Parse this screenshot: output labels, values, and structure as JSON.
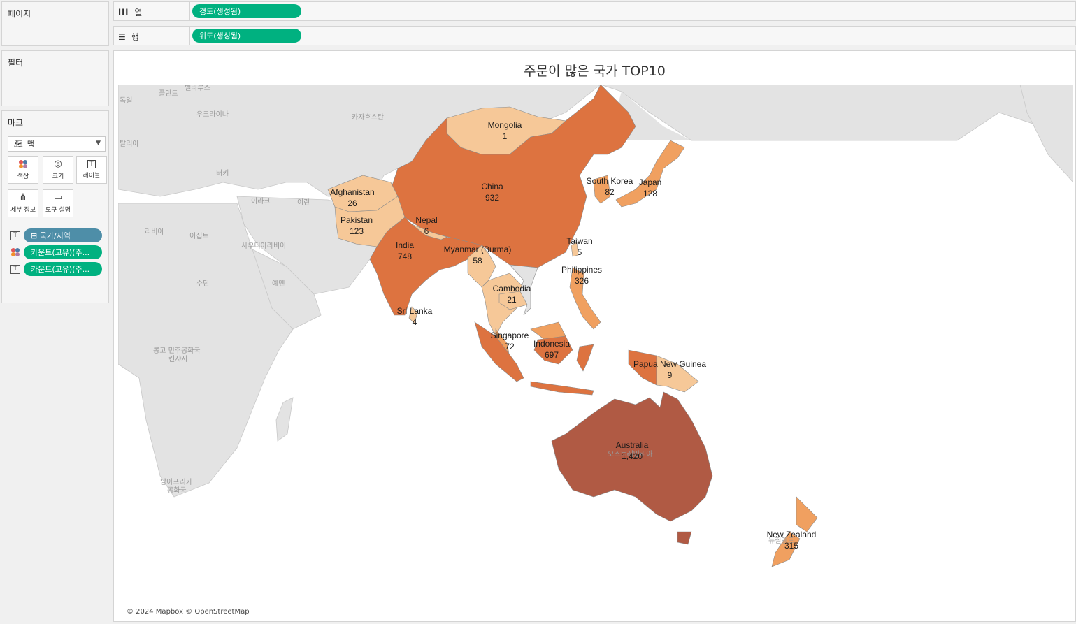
{
  "sidebar": {
    "pages_title": "페이지",
    "filters_title": "필터",
    "marks_title": "마크",
    "mark_type": "맵",
    "mark_buttons": {
      "color": "색상",
      "size": "크기",
      "label": "레이블",
      "detail": "세부 정보",
      "tooltip": "도구 설명"
    },
    "mark_pills": [
      {
        "label": "⊞ 국가/지역",
        "role": "label"
      },
      {
        "label": "카운트(고유)(주...",
        "role": "color"
      },
      {
        "label": "카운트(고유)(주...",
        "role": "label"
      }
    ]
  },
  "shelves": {
    "columns_label": "열",
    "columns_pill": "경도(생성됨)",
    "rows_label": "행",
    "rows_pill": "위도(생성됨)"
  },
  "viz": {
    "title": "주문이 많은 국가 TOP10",
    "attribution": "© 2024 Mapbox © OpenStreetMap"
  },
  "basemap_labels": {
    "poland": "폴란드",
    "belarus": "벨라루스",
    "germany": "독일",
    "ukraine": "우크라이나",
    "kazakhstan": "카자흐스탄",
    "italy": "탈리아",
    "turkey": "터키",
    "iraq": "이라크",
    "iran": "이란",
    "libya": "리비아",
    "egypt": "이집트",
    "saudi": "사우디아라비아",
    "sudan": "수단",
    "yemen": "예멘",
    "drc": "콩고 민주공화국",
    "kinshasa": "킨샤사",
    "south_africa_1": "남아프리카",
    "south_africa_2": "공화국",
    "australia_bg": "오스트레일리아",
    "nz_bg": "뉴질랜드"
  },
  "colors": {
    "scale_low": "#f6c898",
    "scale_mid": "#f0a060",
    "scale_high": "#dd7340",
    "scale_max": "#b05a44",
    "land": "#e3e3e3",
    "water": "#ffffff",
    "pill_green": "#00b180",
    "pill_blue": "#4e8ea8"
  },
  "map_data": {
    "type": "filled-map",
    "measure": "카운트(고유)(주문 ID)",
    "countries": [
      {
        "name": "Mongolia",
        "value": 1
      },
      {
        "name": "China",
        "value": 932
      },
      {
        "name": "South Korea",
        "value": 82
      },
      {
        "name": "Japan",
        "value": 128
      },
      {
        "name": "Afghanistan",
        "value": 26
      },
      {
        "name": "Pakistan",
        "value": 123
      },
      {
        "name": "Nepal",
        "value": 6
      },
      {
        "name": "India",
        "value": 748
      },
      {
        "name": "Myanmar (Burma)",
        "value": 58
      },
      {
        "name": "Taiwan",
        "value": 5
      },
      {
        "name": "Philippines",
        "value": 326
      },
      {
        "name": "Cambodia",
        "value": 21
      },
      {
        "name": "Sri Lanka",
        "value": 4
      },
      {
        "name": "Singapore",
        "value": 72
      },
      {
        "name": "Indonesia",
        "value": 697
      },
      {
        "name": "Papua New Guinea",
        "value": 9
      },
      {
        "name": "Australia",
        "value": 1420
      },
      {
        "name": "New Zealand",
        "value": 315
      }
    ]
  }
}
